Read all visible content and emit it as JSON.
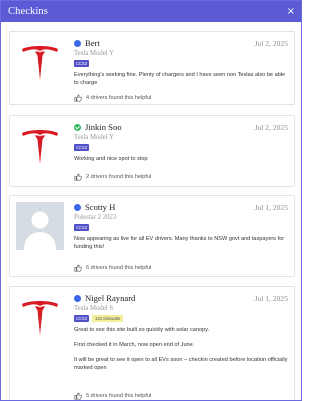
{
  "header": {
    "title": "Checkins",
    "close_label": "×"
  },
  "checkins": [
    {
      "name": "Bert",
      "status": "dot",
      "date": "Jul 2, 2025",
      "vehicle": "Tesla Model Y",
      "connector": "CCS2",
      "comment": [
        "Everything's working fine. Plenty of chargers and I have seen non Teslas also be able to charge"
      ],
      "helpful": "4 drivers found this helpful",
      "avatar": "tesla-logo"
    },
    {
      "name": "Jinkin Soo",
      "status": "check",
      "date": "Jul 2, 2025",
      "vehicle": "Tesla Model Y",
      "connector": "CCS2",
      "comment": [
        "Working and nice spot to stop"
      ],
      "helpful": "2 drivers found this helpful",
      "avatar": "tesla-logo"
    },
    {
      "name": "Scotty H",
      "status": "dot",
      "date": "Jul 1, 2025",
      "vehicle": "Polestar 2 2023",
      "connector": "CCS2",
      "comment": [
        "Now appearing as live for all EV drivers. Many thanks to NSW govt and taxpayers for funding this!"
      ],
      "helpful": "6 drivers found this helpful",
      "avatar": "person-silhouette"
    },
    {
      "name": "Nigel Raynard",
      "status": "dot",
      "date": "Jul 1, 2025",
      "vehicle": "Tesla Model S",
      "connector": "CCS2",
      "power": "131 Kilowatts",
      "comment": [
        "Great to see this site built so quickly with solar canopy.",
        "First checked it in March, now open end of June.",
        "It will be great to see it open to all EVs soon – checkin created before location officially marked open"
      ],
      "helpful": "5 drivers found this helpful",
      "avatar": "tesla-logo"
    }
  ],
  "colors": {
    "header": "#5b5bd6",
    "tesla_red": "#d81c25",
    "dot_blue": "#3c67e8",
    "check_green": "#2db95b"
  }
}
